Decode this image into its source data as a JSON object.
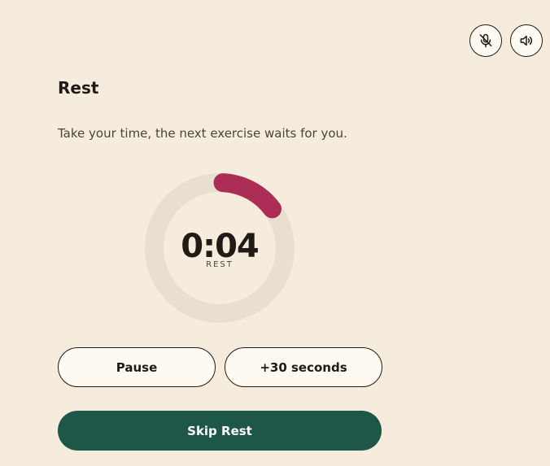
{
  "controls": {
    "mute_mic_icon": "mic-off-icon",
    "speaker_icon": "speaker-icon"
  },
  "rest": {
    "title": "Rest",
    "subtitle": "Take your time, the next exercise waits for you.",
    "timer_value": "0:04",
    "timer_label": "REST",
    "progress_fraction": 0.14
  },
  "actions": {
    "pause_label": "Pause",
    "add_time_label": "+30 seconds",
    "skip_label": "Skip Rest"
  },
  "colors": {
    "background": "#f6ecdd",
    "ring_track": "#e8dfcf",
    "ring_progress": "#ac2d55",
    "primary_button": "#1e5748"
  }
}
